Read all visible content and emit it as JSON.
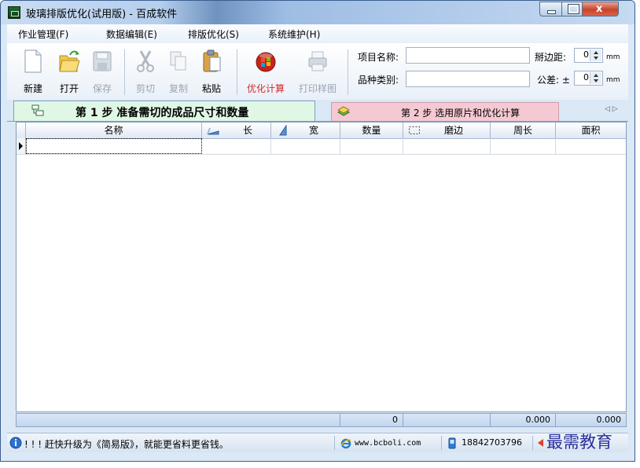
{
  "window": {
    "title": "玻璃排版优化(试用版) - 百成软件",
    "close_glyph": "x"
  },
  "menu": [
    {
      "label": "作业管理(F)"
    },
    {
      "label": "数据编辑(E)"
    },
    {
      "label": "排版优化(S)"
    },
    {
      "label": "系统维护(H)"
    }
  ],
  "toolbar": {
    "buttons": [
      {
        "label": "新建",
        "icon": "new-document-icon",
        "enabled": true
      },
      {
        "label": "打开",
        "icon": "open-folder-icon",
        "enabled": true
      },
      {
        "label": "保存",
        "icon": "floppy-disk-icon",
        "enabled": false
      },
      {
        "label": "剪切",
        "icon": "scissors-icon",
        "enabled": false
      },
      {
        "label": "复制",
        "icon": "copy-icon",
        "enabled": false
      },
      {
        "label": "粘贴",
        "icon": "clipboard-icon",
        "enabled": true
      },
      {
        "label": "优化计算",
        "icon": "optimize-orb-icon",
        "enabled": true
      },
      {
        "label": "打印样图",
        "icon": "printer-icon",
        "enabled": false
      }
    ],
    "accent_label_color": "#d42a2a"
  },
  "fields": {
    "project_label": "项目名称:",
    "project_value": "",
    "category_label": "品种类别:",
    "category_value": "",
    "edge_label": "掰边距:",
    "edge_value": "0",
    "edge_unit": "mm",
    "tolerance_label": "公差: ±",
    "tolerance_value": "0",
    "tolerance_unit": "mm"
  },
  "tabs": {
    "step1": "第 1 步   准备需切的成品尺寸和数量",
    "step2": "第 2 步    选用原片和优化计算",
    "arrows": "◁ ▷",
    "step1_color": "#e0f7e6",
    "step2_color": "#f5c9d3"
  },
  "grid": {
    "columns": [
      "名称",
      "长",
      "宽",
      "数量",
      "磨边",
      "周长",
      "面积"
    ],
    "rows": [
      [
        "",
        "",
        "",
        "",
        "",
        "",
        ""
      ]
    ],
    "footer": {
      "qty_total": "0",
      "perimeter_total": "0.000",
      "area_total": "0.000"
    }
  },
  "status": {
    "message": "! ! !  赶快升级为《简易版》，就能更省料更省钱。",
    "website": "www.bcboli.com",
    "phone": "18842703796",
    "watermark": "最需教育"
  }
}
